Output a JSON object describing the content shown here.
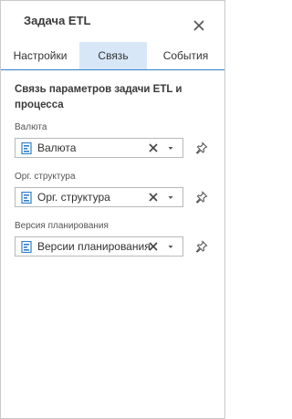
{
  "dialog": {
    "title": "Задача ETL",
    "close_icon": "close-icon"
  },
  "tabs": [
    {
      "label": "Настройки",
      "active": false
    },
    {
      "label": "Связь",
      "active": true
    },
    {
      "label": "События",
      "active": false
    }
  ],
  "section": {
    "title": "Связь параметров задачи ETL и процесса"
  },
  "fields": [
    {
      "label": "Валюта",
      "value": "Валюта",
      "icon": "dimension-icon"
    },
    {
      "label": "Орг. структура",
      "value": "Орг. структура",
      "icon": "dimension-icon"
    },
    {
      "label": "Версия планирования",
      "value": "Версии планирования",
      "icon": "dimension-icon"
    }
  ],
  "colors": {
    "accent": "#2f7fc9",
    "active_tab_bg": "#d8e7f8",
    "border": "#b8b8b8"
  }
}
